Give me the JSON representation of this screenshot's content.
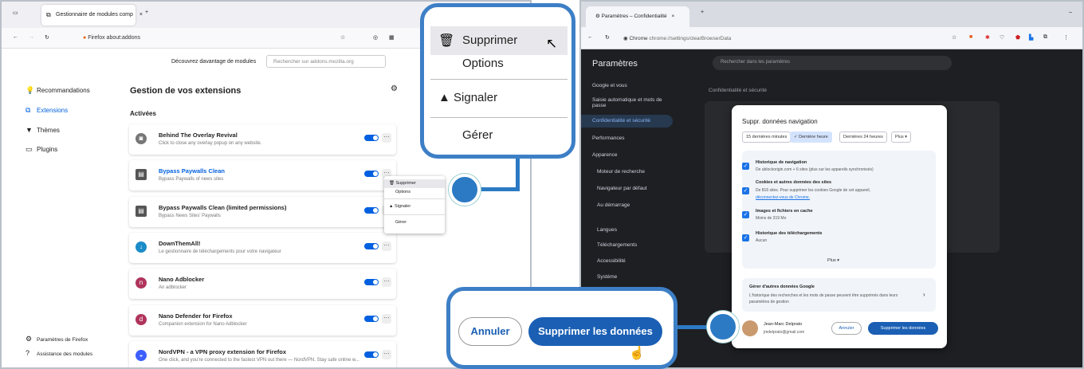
{
  "firefox": {
    "tab_title": "Gestionnaire de modules comp",
    "url_brand": "Firefox",
    "url": "about:addons",
    "discover_label": "Découvrez davantage de modules",
    "search_placeholder": "Rechercher sur addons.mozilla.org",
    "sidebar": [
      {
        "label": "Recommandations",
        "icon": "lightbulb-icon"
      },
      {
        "label": "Extensions",
        "icon": "puzzle-icon"
      },
      {
        "label": "Thèmes",
        "icon": "brush-icon"
      },
      {
        "label": "Plugins",
        "icon": "plugin-icon"
      }
    ],
    "sidebar_footer": [
      "Paramètres de Firefox",
      "Assistance des modules"
    ],
    "heading": "Gestion de vos extensions",
    "section_label": "Activées",
    "extensions": [
      {
        "name": "Behind The Overlay Revival",
        "desc": "Click to close any overlay popup on any website.",
        "icon": "overlay-icon",
        "color": "#777"
      },
      {
        "name": "Bypass Paywalls Clean",
        "desc": "Bypass Paywalls of news sites",
        "icon": "paywall-icon",
        "color": "#555"
      },
      {
        "name": "Bypass Paywalls Clean (limited permissions)",
        "desc": "Bypass News Sites' Paywalls",
        "icon": "paywall-icon",
        "color": "#555"
      },
      {
        "name": "DownThemAll!",
        "desc": "Le gestionnaire de téléchargements pour votre navigateur",
        "icon": "download-icon",
        "color": "#1a8cc8"
      },
      {
        "name": "Nano Adblocker",
        "desc": "An adblocker",
        "icon": "nano-icon",
        "color": "#b0345c"
      },
      {
        "name": "Nano Defender for Firefox",
        "desc": "Companion extension for Nano Adblocker",
        "icon": "nano-defender-icon",
        "color": "#b0345c"
      },
      {
        "name": "NordVPN - a VPN proxy extension for Firefox",
        "desc": "One click, and you're connected to the fastest VPN out there — NordVPN. Stay safe online w...",
        "icon": "nordvpn-icon",
        "color": "#3e5fff"
      }
    ],
    "menu": {
      "items": [
        "Supprimer",
        "Options",
        "Signaler",
        "Gérer"
      ]
    }
  },
  "zoom_menu": {
    "delete": "Supprimer",
    "options": "Options",
    "report": "Signaler",
    "manage": "Gérer"
  },
  "chrome": {
    "tab_title": "Paramètres – Confidentialité",
    "url_brand": "Chrome",
    "url": "chrome://settings/clearBrowserData",
    "settings_title": "Paramètres",
    "search_placeholder": "Rechercher dans les paramètres",
    "sidebar": [
      "Google et vous",
      "Saisie automatique et mots de passe",
      "Confidentialité et sécurité",
      "Performances",
      "Apparence",
      "Moteur de recherche",
      "Navigateur par défaut",
      "Au démarrage",
      "Langues",
      "Téléchargements",
      "Accessibilité",
      "Système"
    ],
    "section_title": "Confidentialité et sécurité",
    "dialog": {
      "title": "Suppr. données navigation",
      "chips": [
        "15 dernières minutes",
        "Dernière heure",
        "Dernières 24 heures",
        "Plus"
      ],
      "items": [
        {
          "title": "Historique de navigation",
          "desc": "De ublockorigin.com + 6 sites (plus sur les appareils synchronisés)"
        },
        {
          "title": "Cookies et autres données des sites",
          "desc": "De 816 sites. Pour supprimer les cookies Google de cet appareil,",
          "link": "déconnectez-vous de Chrome."
        },
        {
          "title": "Images et fichiers en cache",
          "desc": "Moins de 319 Mo"
        },
        {
          "title": "Historique des téléchargements",
          "desc": "Aucun"
        }
      ],
      "more": "Plus",
      "other_title": "Gérer d'autres données Google",
      "other_desc": "L'historique des recherches et les mots de passe peuvent être supprimés dans leurs paramètres de gestion",
      "user_name": "Jean-Marc Delprato",
      "user_email": "jmdelprato@gmail.com",
      "cancel": "Annuler",
      "confirm": "Supprimer les données"
    }
  },
  "zoom_buttons": {
    "cancel": "Annuler",
    "confirm": "Supprimer les données"
  }
}
